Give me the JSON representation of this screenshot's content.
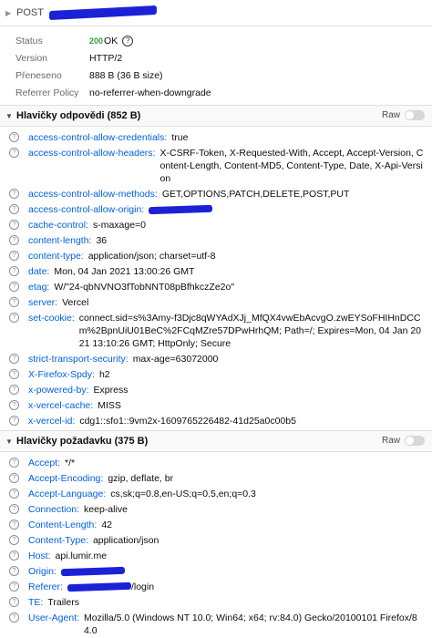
{
  "request": {
    "method": "POST"
  },
  "summary": {
    "status_label": "Status",
    "status_code": "200",
    "status_text": "OK",
    "version_label": "Version",
    "version": "HTTP/2",
    "transferred_label": "Přeneseno",
    "transferred": "888 B (36 B size)",
    "referrer_label": "Referrer Policy",
    "referrer": "no-referrer-when-downgrade"
  },
  "response_headers": {
    "title": "Hlavičky odpovědi (852 B)",
    "raw_label": "Raw",
    "items": [
      {
        "name": "access-control-allow-credentials:",
        "value": "true"
      },
      {
        "name": "access-control-allow-headers:",
        "value": "X-CSRF-Token, X-Requested-With, Accept, Accept-Version, Content-Length, Content-MD5, Content-Type, Date, X-Api-Version"
      },
      {
        "name": "access-control-allow-methods:",
        "value": "GET,OPTIONS,PATCH,DELETE,POST,PUT"
      },
      {
        "name": "access-control-allow-origin:",
        "value": ""
      },
      {
        "name": "cache-control:",
        "value": "s-maxage=0"
      },
      {
        "name": "content-length:",
        "value": "36"
      },
      {
        "name": "content-type:",
        "value": "application/json; charset=utf-8"
      },
      {
        "name": "date:",
        "value": "Mon, 04 Jan 2021 13:00:26 GMT"
      },
      {
        "name": "etag:",
        "value": "W/\"24-qbNVNO3fTobNNT08pBfhkczZe2o\""
      },
      {
        "name": "server:",
        "value": "Vercel"
      },
      {
        "name": "set-cookie:",
        "value": "connect.sid=s%3Amy-f3Djc8qWYAdXJj_MfQX4vwEbAcvgO.zwEYSoFHIHnDCCm%2BpnUiU01BeC%2FCqMZre57DPwHrhQM; Path=/; Expires=Mon, 04 Jan 2021 13:10:26 GMT; HttpOnly; Secure"
      },
      {
        "name": "strict-transport-security:",
        "value": "max-age=63072000"
      },
      {
        "name": "X-Firefox-Spdy:",
        "value": "h2"
      },
      {
        "name": "x-powered-by:",
        "value": "Express"
      },
      {
        "name": "x-vercel-cache:",
        "value": "MISS"
      },
      {
        "name": "x-vercel-id:",
        "value": "cdg1::sfo1::9vm2x-1609765226482-41d25a0c00b5"
      }
    ]
  },
  "request_headers": {
    "title": "Hlavičky požadavku (375 B)",
    "raw_label": "Raw",
    "items": [
      {
        "name": "Accept:",
        "value": "*/*"
      },
      {
        "name": "Accept-Encoding:",
        "value": "gzip, deflate, br"
      },
      {
        "name": "Accept-Language:",
        "value": "cs,sk;q=0.8,en-US;q=0.5,en;q=0.3"
      },
      {
        "name": "Connection:",
        "value": "keep-alive"
      },
      {
        "name": "Content-Length:",
        "value": "42"
      },
      {
        "name": "Content-Type:",
        "value": "application/json"
      },
      {
        "name": "Host:",
        "value": "api.lumir.me"
      },
      {
        "name": "Origin:",
        "value": ""
      },
      {
        "name": "Referer:",
        "value": "/login"
      },
      {
        "name": "TE:",
        "value": "Trailers"
      },
      {
        "name": "User-Agent:",
        "value": "Mozilla/5.0 (Windows NT 10.0; Win64; x64; rv:84.0) Gecko/20100101 Firefox/84.0"
      }
    ]
  }
}
